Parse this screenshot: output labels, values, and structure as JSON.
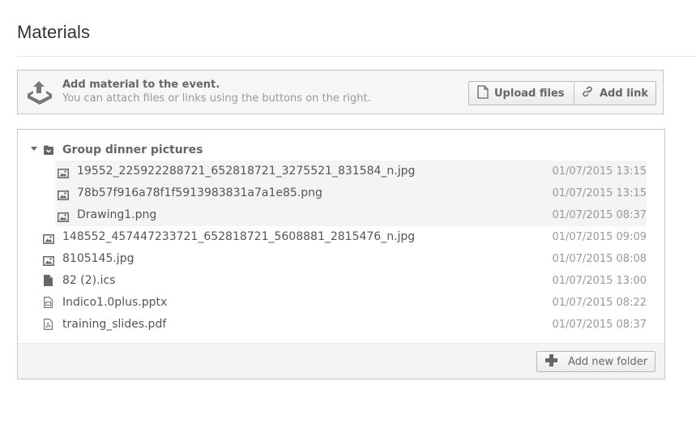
{
  "page": {
    "title": "Materials"
  },
  "upload_box": {
    "heading": "Add material to the event.",
    "subtext": "You can attach files or links using the buttons on the right.",
    "upload_label": "Upload files",
    "link_label": "Add link"
  },
  "tree": {
    "folder": {
      "name": "Group dinner pictures",
      "files": [
        {
          "name": "19552_225922288721_652818721_3275521_831584_n.jpg",
          "date": "01/07/2015 13:15",
          "icon": "image-icon"
        },
        {
          "name": "78b57f916a78f1f5913983831a7a1e85.png",
          "date": "01/07/2015 13:15",
          "icon": "image-icon"
        },
        {
          "name": "Drawing1.png",
          "date": "01/07/2015 08:37",
          "icon": "image-icon"
        }
      ]
    },
    "files": [
      {
        "name": "148552_457447233721_652818721_5608881_2815476_n.jpg",
        "date": "01/07/2015 09:09",
        "icon": "image-icon"
      },
      {
        "name": "8105145.jpg",
        "date": "01/07/2015 08:08",
        "icon": "image-icon"
      },
      {
        "name": "82 (2).ics",
        "date": "01/07/2015 13:00",
        "icon": "file-icon"
      },
      {
        "name": "Indico1.0plus.pptx",
        "date": "01/07/2015 08:22",
        "icon": "presentation-icon"
      },
      {
        "name": "training_slides.pdf",
        "date": "01/07/2015 08:37",
        "icon": "pdf-icon"
      }
    ],
    "add_folder_label": "Add new folder"
  }
}
